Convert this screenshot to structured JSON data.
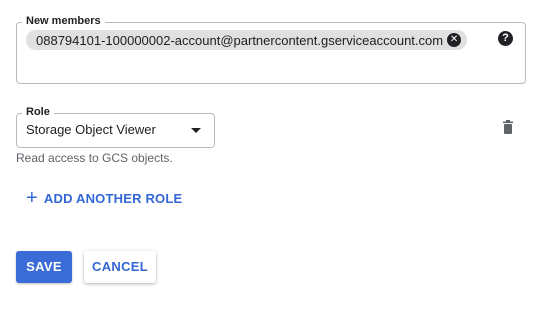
{
  "members": {
    "label": "New members",
    "chip_text": "088794101-100000002-account@partnercontent.gserviceaccount.com",
    "chip_remove_icon": "cancel-circle-icon",
    "help_icon": "help-icon",
    "help_glyph": "?"
  },
  "role": {
    "label": "Role",
    "selected_value": "Storage Object Viewer",
    "description": "Read access to GCS objects.",
    "dropdown_icon": "arrow-drop-down-icon",
    "delete_icon": "trash-icon"
  },
  "add_role": {
    "icon": "plus-icon",
    "label": "ADD ANOTHER ROLE"
  },
  "actions": {
    "save_label": "SAVE",
    "cancel_label": "CANCEL"
  },
  "colors": {
    "accent": "#3367d6",
    "primary_button": "#3b6bd6",
    "chip_background": "#e0e0e0",
    "field_border": "#b8bbbe",
    "secondary_text": "#5f6368"
  }
}
